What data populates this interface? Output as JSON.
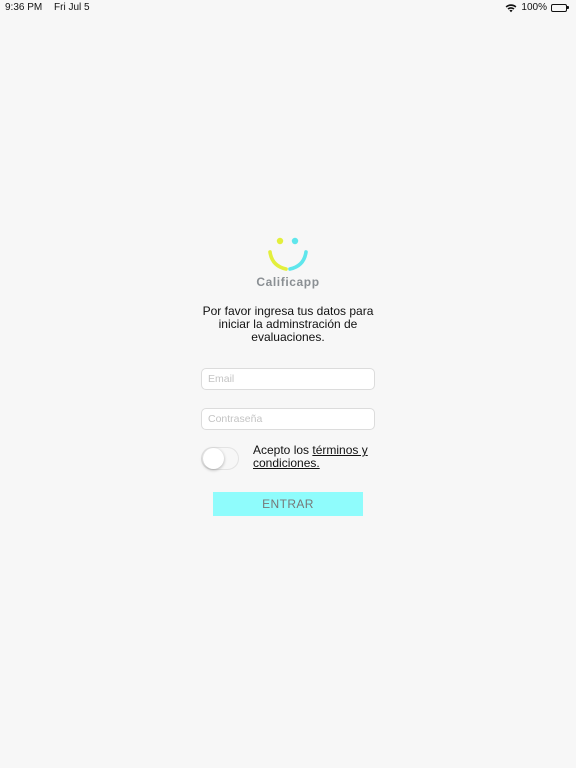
{
  "status_bar": {
    "time": "9:36 PM",
    "date": "Fri Jul 5",
    "battery": "100%",
    "icons": [
      "wifi-icon",
      "battery-icon"
    ]
  },
  "logo": {
    "app_name": "Calificapp",
    "colors": {
      "left": "#e3ef3c",
      "right": "#5fe6ec",
      "text": "#8a8f93"
    }
  },
  "intro": {
    "text": "Por favor ingresa tus datos para iniciar la adminstración de evaluaciones."
  },
  "form": {
    "email": {
      "value": "",
      "placeholder": "Email"
    },
    "password": {
      "value": "",
      "placeholder": "Contraseña"
    },
    "terms": {
      "prefix": "Acepto los ",
      "link_label": "términos y condiciones.",
      "accepted": false
    },
    "submit_label": "ENTRAR"
  },
  "colors": {
    "background": "#f7f7f7",
    "button": "#8ffcfc",
    "button_text": "#777777"
  }
}
